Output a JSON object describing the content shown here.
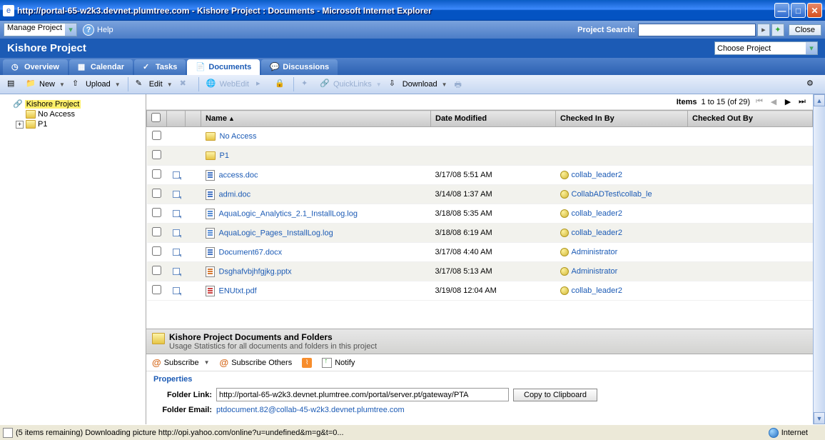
{
  "titlebar": {
    "text": "http://portal-65-w2k3.devnet.plumtree.com - Kishore Project : Documents - Microsoft Internet Explorer"
  },
  "toolbar1": {
    "manage_label": "Manage Project",
    "help_label": "Help",
    "search_label": "Project Search:",
    "close_label": "Close"
  },
  "project": {
    "title": "Kishore Project",
    "choose_label": "Choose Project"
  },
  "tabs": {
    "overview": "Overview",
    "calendar": "Calendar",
    "tasks": "Tasks",
    "documents": "Documents",
    "discussions": "Discussions"
  },
  "actions": {
    "new": "New",
    "upload": "Upload",
    "edit": "Edit",
    "webedit": "WebEdit",
    "quicklinks": "QuickLinks",
    "download": "Download"
  },
  "tree": {
    "root": "Kishore Project",
    "noaccess": "No Access",
    "p1": "P1"
  },
  "pagination": {
    "label": "Items",
    "range": "1 to 15 (of 29)"
  },
  "columns": {
    "name": "Name",
    "date_modified": "Date Modified",
    "checked_in": "Checked In By",
    "checked_out": "Checked Out By"
  },
  "rows": [
    {
      "type": "folder",
      "name": "No Access",
      "date": "",
      "checkin": ""
    },
    {
      "type": "folder",
      "name": "P1",
      "date": "",
      "checkin": ""
    },
    {
      "type": "file",
      "ext": "doc",
      "name": "access.doc",
      "date": "3/17/08 5:51 AM",
      "checkin": "collab_leader2"
    },
    {
      "type": "file",
      "ext": "doc",
      "name": "admi.doc",
      "date": "3/14/08 1:37 AM",
      "checkin": "CollabADTest\\collab_le"
    },
    {
      "type": "file",
      "ext": "log",
      "name": "AquaLogic_Analytics_2.1_InstallLog.log",
      "date": "3/18/08 5:35 AM",
      "checkin": "collab_leader2"
    },
    {
      "type": "file",
      "ext": "log",
      "name": "AquaLogic_Pages_InstallLog.log",
      "date": "3/18/08 6:19 AM",
      "checkin": "collab_leader2"
    },
    {
      "type": "file",
      "ext": "docx",
      "name": "Document67.docx",
      "date": "3/17/08 4:40 AM",
      "checkin": "Administrator"
    },
    {
      "type": "file",
      "ext": "ppt",
      "name": "Dsghafvbjhfgjkg.pptx",
      "date": "3/17/08 5:13 AM",
      "checkin": "Administrator"
    },
    {
      "type": "file",
      "ext": "pdf",
      "name": "ENUtxt.pdf",
      "date": "3/19/08 12:04 AM",
      "checkin": "collab_leader2"
    }
  ],
  "summary": {
    "title": "Kishore Project Documents and Folders",
    "subtitle": "Usage Statistics for all documents and folders in this project"
  },
  "subscribe": {
    "subscribe": "Subscribe",
    "subscribe_others": "Subscribe Others",
    "notify": "Notify"
  },
  "properties": {
    "title": "Properties",
    "folder_link_label": "Folder Link:",
    "folder_link_value": "http://portal-65-w2k3.devnet.plumtree.com/portal/server.pt/gateway/PTA",
    "copy_btn": "Copy to Clipboard",
    "folder_email_label": "Folder Email:",
    "folder_email_value": "ptdocument.82@collab-45-w2k3.devnet.plumtree.com"
  },
  "statusbar": {
    "text": "(5 items remaining) Downloading picture http://opi.yahoo.com/online?u=undefined&m=g&t=0...",
    "zone": "Internet"
  }
}
